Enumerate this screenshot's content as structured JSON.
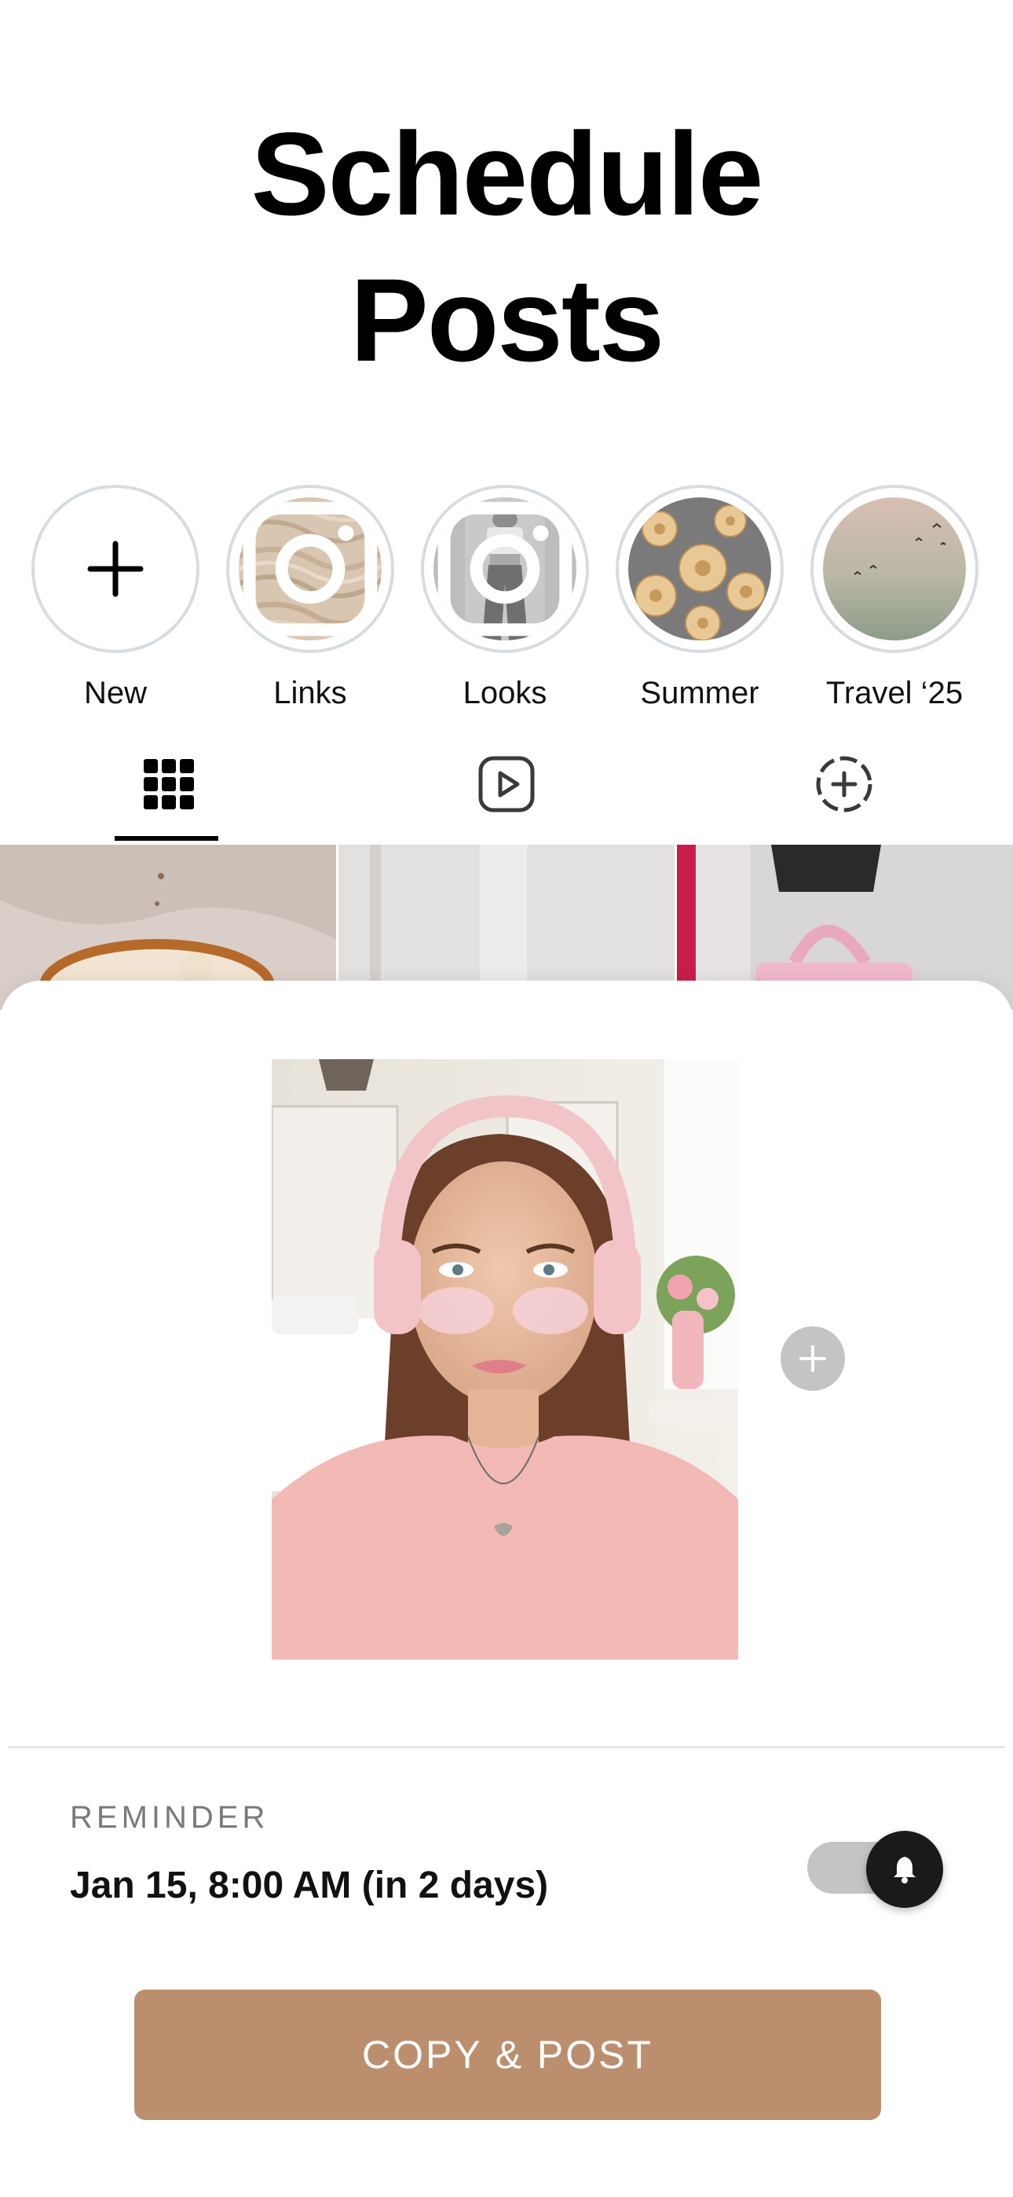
{
  "page": {
    "title_line1": "Schedule",
    "title_line2": "Posts"
  },
  "highlights": [
    {
      "label": "New",
      "icon": "plus-icon"
    },
    {
      "label": "Links",
      "icon": "instagram-icon"
    },
    {
      "label": "Looks",
      "icon": "instagram-icon"
    },
    {
      "label": "Summer",
      "icon": ""
    },
    {
      "label": "Travel ‘25",
      "icon": ""
    }
  ],
  "tabs": [
    {
      "icon": "grid-icon",
      "selected": true
    },
    {
      "icon": "reels-icon",
      "selected": false
    },
    {
      "icon": "add-circle-dashed-icon",
      "selected": false
    }
  ],
  "reminder": {
    "label": "REMINDER",
    "value": "Jan 15, 8:00 AM (in 2 days)",
    "enabled": true
  },
  "cta": {
    "label": "COPY & POST"
  },
  "colors": {
    "accent": "#bb8e6e",
    "ring": "#d7dce0",
    "toggle_track": "#c4c4c4",
    "toggle_knob": "#1a1a1a"
  }
}
